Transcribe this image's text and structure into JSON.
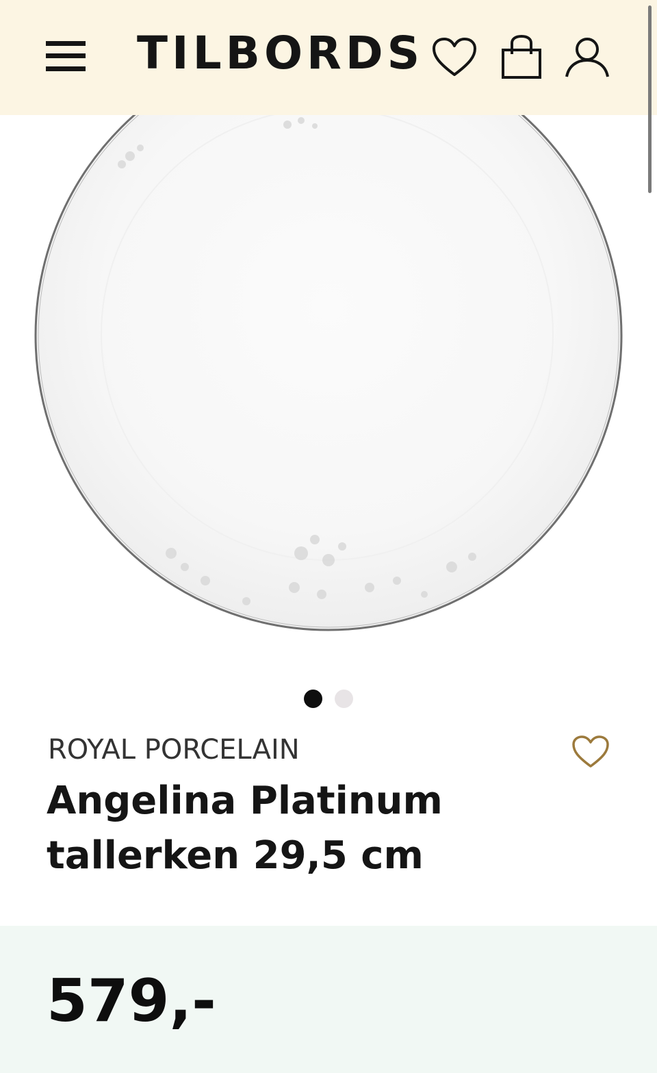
{
  "header": {
    "logo": "TILBORDS",
    "background": "#fcf5e3",
    "icons": [
      "menu-icon",
      "heart-icon",
      "shopping-bag-icon",
      "user-icon"
    ]
  },
  "gallery": {
    "image": "plate-image",
    "slides_total": 2,
    "active_slide": 1
  },
  "product": {
    "brand": "ROYAL PORCELAIN",
    "name": "Angelina Platinum tallerken 29,5 cm",
    "favorite_icon": "heart-outline-icon",
    "favorite_color": "#9c7a3c"
  },
  "price": {
    "value": "579,-",
    "background": "#f1f8f4"
  }
}
